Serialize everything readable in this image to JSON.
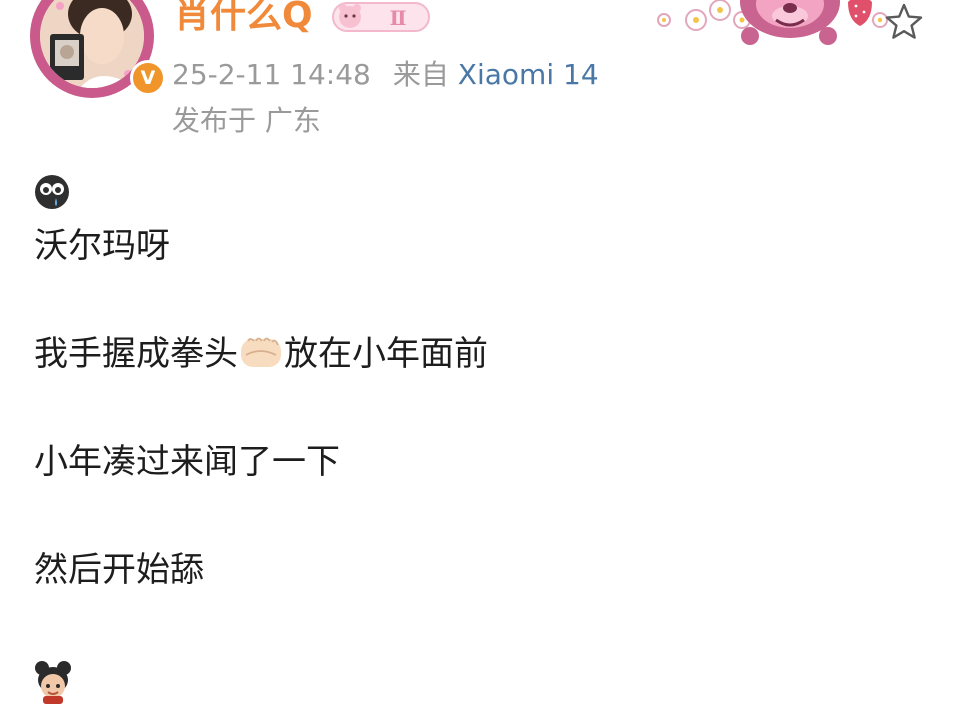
{
  "post": {
    "author": {
      "name": "肖什么Q",
      "avatar_icon": "avatar-photo",
      "verified_icon": "orange-verified-badge-icon",
      "verified_symbol": "V",
      "name_badge_icon": "pink-bear-level-badge-icon",
      "name_badge_text": "Ⅱ"
    },
    "timestamp": "25-2-11 14:48",
    "source_prefix": "来自",
    "device": "Xiaomi 14",
    "location": "发布于 广东",
    "decoration": "lotso-bear-card-decoration-icon",
    "favorite_icon": "star-icon",
    "content": {
      "leading_emoji": "emoji-crying-eyes-icon",
      "line1": "沃尔玛呀",
      "line2_before": "我手握成拳头",
      "line2_emoji": "fist-emoji-icon",
      "line2_after": "放在小年面前",
      "line3": "小年凑过来闻了一下",
      "line4": "然后开始舔",
      "trailing_emoji": "emoji-girl-character-icon"
    }
  },
  "colors": {
    "username": "#f08a3a",
    "meta": "#9a9a9a",
    "device": "#4a78a6",
    "text": "#1d1d1d",
    "avatar_ring": "#c95a8b",
    "verified": "#f0952a"
  }
}
